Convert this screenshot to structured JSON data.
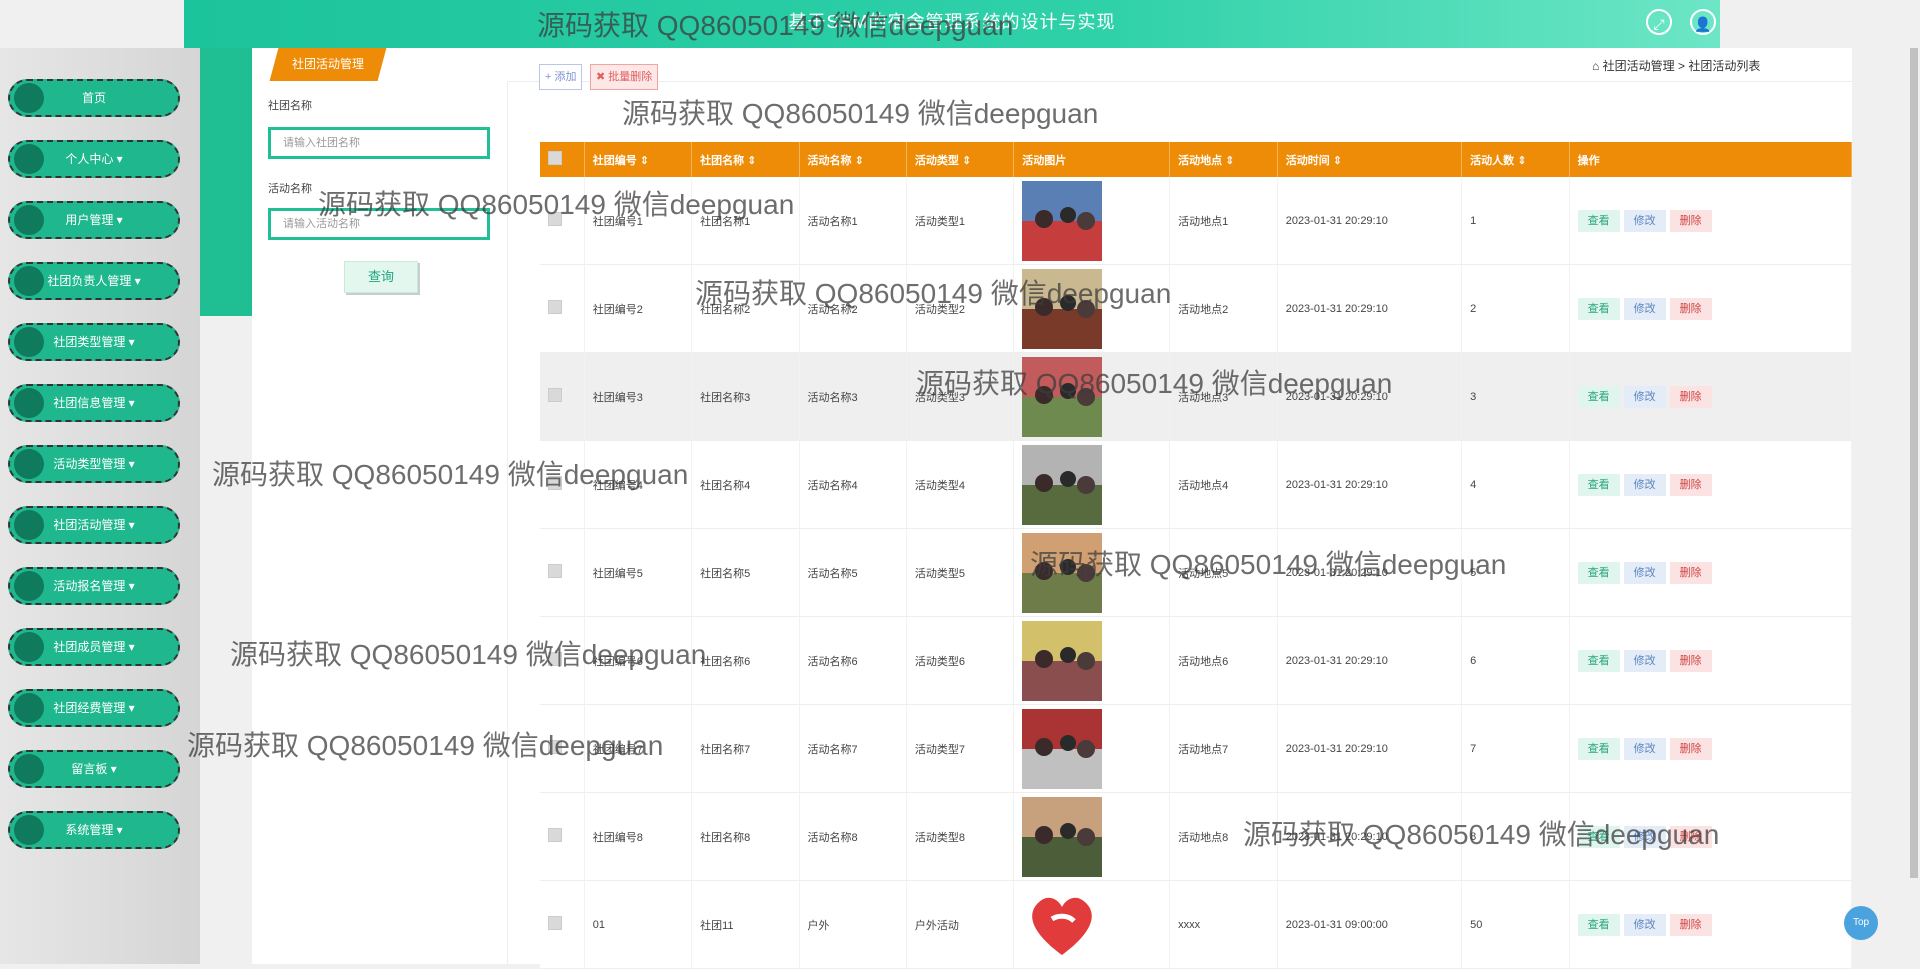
{
  "header": {
    "title": "基于SSM的宿舍管理系统的设计与实现"
  },
  "sidebar": {
    "items": [
      {
        "label": "首页"
      },
      {
        "label": "个人中心 ▾"
      },
      {
        "label": "用户管理 ▾"
      },
      {
        "label": "社团负责人管理 ▾"
      },
      {
        "label": "社团类型管理 ▾"
      },
      {
        "label": "社团信息管理 ▾"
      },
      {
        "label": "活动类型管理 ▾"
      },
      {
        "label": "社团活动管理 ▾"
      },
      {
        "label": "活动报名管理 ▾"
      },
      {
        "label": "社团成员管理 ▾"
      },
      {
        "label": "社团经费管理 ▾"
      },
      {
        "label": "留言板 ▾"
      },
      {
        "label": "系统管理 ▾"
      }
    ]
  },
  "tab": {
    "label": "社团活动管理"
  },
  "breadcrumb": {
    "home": "社团活动管理",
    "sep": ">",
    "current": "社团活动列表"
  },
  "filters": {
    "club_name_label": "社团名称",
    "club_name_placeholder": "请输入社团名称",
    "activity_name_label": "活动名称",
    "activity_name_placeholder": "请输入活动名称",
    "query_label": "查询"
  },
  "toolbar": {
    "add_label": "+ 添加",
    "batch_delete_label": "✖ 批量删除"
  },
  "table": {
    "columns": [
      "社团编号",
      "社团名称",
      "活动名称",
      "活动类型",
      "活动图片",
      "活动地点",
      "活动时间",
      "活动人数",
      "操作"
    ],
    "rows": [
      {
        "code": "社团编号1",
        "club": "社团名称1",
        "activity": "活动名称1",
        "type": "活动类型1",
        "place": "活动地点1",
        "time": "2023-01-31 20:29:10",
        "count": "1"
      },
      {
        "code": "社团编号2",
        "club": "社团名称2",
        "activity": "活动名称2",
        "type": "活动类型2",
        "place": "活动地点2",
        "time": "2023-01-31 20:29:10",
        "count": "2"
      },
      {
        "code": "社团编号3",
        "club": "社团名称3",
        "activity": "活动名称3",
        "type": "活动类型3",
        "place": "活动地点3",
        "time": "2023-01-31 20:29:10",
        "count": "3"
      },
      {
        "code": "社团编号4",
        "club": "社团名称4",
        "activity": "活动名称4",
        "type": "活动类型4",
        "place": "活动地点4",
        "time": "2023-01-31 20:29:10",
        "count": "4"
      },
      {
        "code": "社团编号5",
        "club": "社团名称5",
        "activity": "活动名称5",
        "type": "活动类型5",
        "place": "活动地点5",
        "time": "2023-01-31 20:29:10",
        "count": "5"
      },
      {
        "code": "社团编号6",
        "club": "社团名称6",
        "activity": "活动名称6",
        "type": "活动类型6",
        "place": "活动地点6",
        "time": "2023-01-31 20:29:10",
        "count": "6"
      },
      {
        "code": "社团编号7",
        "club": "社团名称7",
        "activity": "活动名称7",
        "type": "活动类型7",
        "place": "活动地点7",
        "time": "2023-01-31 20:29:10",
        "count": "7"
      },
      {
        "code": "社团编号8",
        "club": "社团名称8",
        "activity": "活动名称8",
        "type": "活动类型8",
        "place": "活动地点8",
        "time": "2023-01-31 20:29:10",
        "count": "8"
      },
      {
        "code": "01",
        "club": "社团11",
        "activity": "户外",
        "type": "户外活动",
        "place": "xxxx",
        "time": "2023-01-31 09:00:00",
        "count": "50"
      }
    ],
    "actions": {
      "view": "查看",
      "edit": "修改",
      "delete": "删除"
    }
  },
  "watermark": {
    "text": "源码获取 QQ86050149 微信deepguan"
  },
  "top_button": {
    "label": "Top"
  },
  "colors": {
    "accent": "#1fbf93",
    "header_orange": "#ef8c07"
  }
}
